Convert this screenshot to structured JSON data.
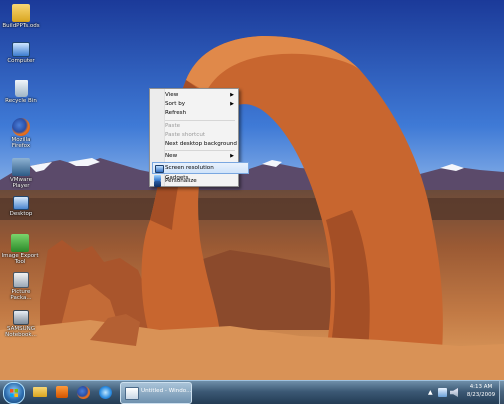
{
  "desktop_icons": [
    {
      "label": "BuildPPTs.ods"
    },
    {
      "label": "Computer"
    },
    {
      "label": "Recycle Bin"
    },
    {
      "label": "Mozilla Firefox"
    },
    {
      "label": "VMware Player"
    },
    {
      "label": "Desktop"
    },
    {
      "label": "Image Export Tool"
    },
    {
      "label": "Picture Packa..."
    },
    {
      "label": "SAMSUNG Notebook..."
    }
  ],
  "context_menu": {
    "items": [
      {
        "label": "View",
        "has_submenu": true,
        "enabled": true
      },
      {
        "label": "Sort by",
        "has_submenu": true,
        "enabled": true
      },
      {
        "label": "Refresh",
        "has_submenu": false,
        "enabled": true
      },
      {
        "label": "Paste",
        "has_submenu": false,
        "enabled": false
      },
      {
        "label": "Paste shortcut",
        "has_submenu": false,
        "enabled": false
      },
      {
        "label": "Next desktop background",
        "has_submenu": false,
        "enabled": true
      },
      {
        "label": "New",
        "has_submenu": true,
        "enabled": true
      },
      {
        "label": "Screen resolution",
        "has_submenu": false,
        "enabled": true,
        "highlighted": true,
        "icon": "monitor-icon"
      },
      {
        "label": "Gadgets",
        "has_submenu": false,
        "enabled": true,
        "icon": "gadgets-icon"
      },
      {
        "label": "Personalize",
        "has_submenu": false,
        "enabled": true,
        "icon": "personalize-icon"
      }
    ],
    "submenu_arrow": "▶"
  },
  "taskbar": {
    "active_window_label": "Untitled - Windo...",
    "clock_time": "4:13 AM",
    "clock_date": "8/23/2009"
  },
  "colors": {
    "taskbar": "#2b4660",
    "menu_bg": "#f3f3f3",
    "menu_highlight": "#cfe3fa"
  }
}
